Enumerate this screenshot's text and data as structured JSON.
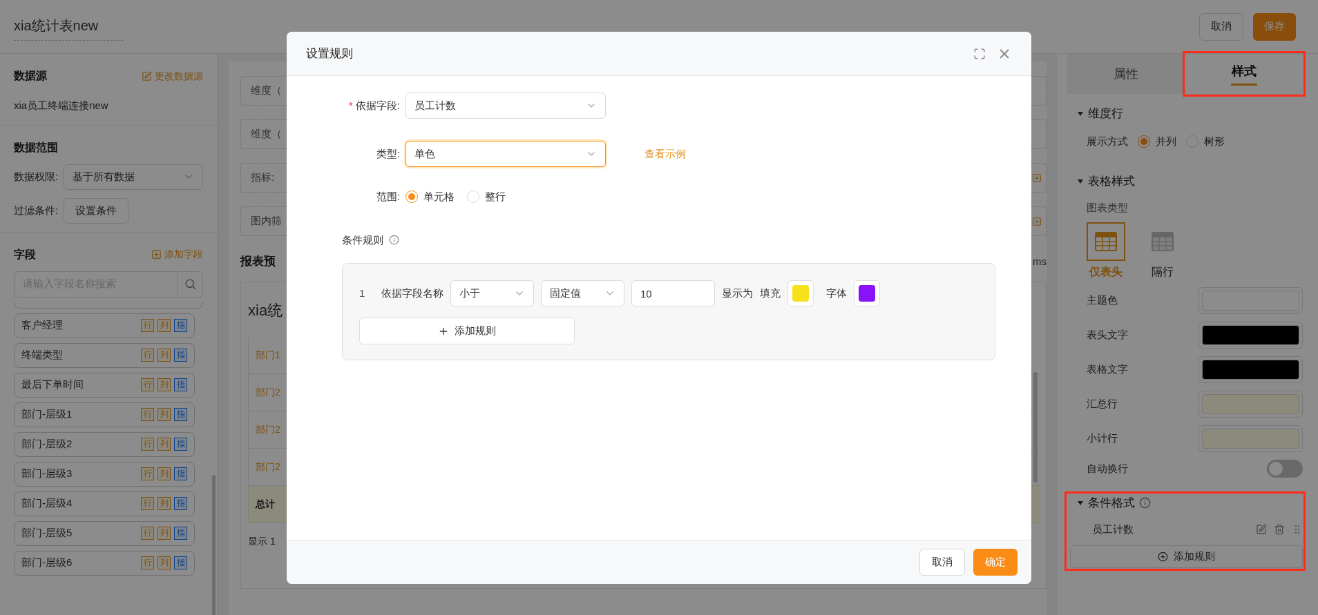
{
  "header": {
    "title": "xia统计表new",
    "buttons": [
      {
        "label": "取消",
        "kind": "secondary"
      },
      {
        "label": "保存",
        "kind": "primary"
      }
    ]
  },
  "sidebar": {
    "data_source": {
      "title": "数据源",
      "action": "更改数据源",
      "value": "xia员工终端连接new"
    },
    "data_range": {
      "title": "数据范围",
      "permission_label": "数据权限:",
      "permission_value": "基于所有数据",
      "filter_label": "过滤条件:",
      "filter_button": "设置条件"
    },
    "fields": {
      "title": "字段",
      "action": "添加字段",
      "search": {
        "placeholder": "请输入字段名称搜索"
      },
      "items": [
        {
          "name": "客户经理",
          "tags": [
            {
              "label": "行",
              "kind": "dimension"
            },
            {
              "label": "列",
              "kind": "dimension"
            },
            {
              "label": "指",
              "kind": "measure"
            }
          ]
        },
        {
          "name": "终端类型",
          "tags": [
            {
              "label": "行",
              "kind": "dimension"
            },
            {
              "label": "列",
              "kind": "dimension"
            },
            {
              "label": "指",
              "kind": "measure"
            }
          ]
        },
        {
          "name": "最后下单时间",
          "tags": [
            {
              "label": "行",
              "kind": "dimension"
            },
            {
              "label": "列",
              "kind": "dimension"
            },
            {
              "label": "指",
              "kind": "measure"
            }
          ]
        },
        {
          "name": "部门-层级1",
          "tags": [
            {
              "label": "行",
              "kind": "dimension"
            },
            {
              "label": "列",
              "kind": "dimension"
            },
            {
              "label": "指",
              "kind": "measure"
            }
          ]
        },
        {
          "name": "部门-层级2",
          "tags": [
            {
              "label": "行",
              "kind": "dimension"
            },
            {
              "label": "列",
              "kind": "dimension"
            },
            {
              "label": "指",
              "kind": "measure"
            }
          ]
        },
        {
          "name": "部门-层级3",
          "tags": [
            {
              "label": "行",
              "kind": "dimension"
            },
            {
              "label": "列",
              "kind": "dimension"
            },
            {
              "label": "指",
              "kind": "measure"
            }
          ]
        },
        {
          "name": "部门-层级4",
          "tags": [
            {
              "label": "行",
              "kind": "dimension"
            },
            {
              "label": "列",
              "kind": "dimension"
            },
            {
              "label": "指",
              "kind": "measure"
            }
          ]
        },
        {
          "name": "部门-层级5",
          "tags": [
            {
              "label": "行",
              "kind": "dimension"
            },
            {
              "label": "列",
              "kind": "dimension"
            },
            {
              "label": "指",
              "kind": "measure"
            }
          ]
        },
        {
          "name": "部门-层级6",
          "tags": [
            {
              "label": "行",
              "kind": "dimension"
            },
            {
              "label": "列",
              "kind": "dimension"
            },
            {
              "label": "指",
              "kind": "measure"
            }
          ]
        }
      ]
    }
  },
  "workspace": {
    "drop_zones": [
      {
        "label": "维度（",
        "has_action": false
      },
      {
        "label": "维度（",
        "has_action": false
      },
      {
        "label": "指标:",
        "has_action": true
      },
      {
        "label": "图内筛",
        "has_action": true
      }
    ],
    "preview_title": "报表预",
    "side_text": "ms",
    "card_title": "xia统",
    "rows": [
      {
        "label": "部门1",
        "kind": "group"
      },
      {
        "label": "部门2",
        "kind": "group"
      },
      {
        "label": "部门2",
        "kind": "group"
      },
      {
        "label": "部门2",
        "kind": "group"
      },
      {
        "label": "总计",
        "kind": "total"
      }
    ],
    "footer": "显示 1"
  },
  "style_panel": {
    "tabs": [
      {
        "label": "属性",
        "selected": false,
        "highlighted": false
      },
      {
        "label": "样式",
        "selected": true,
        "highlighted": true
      }
    ],
    "dimension_row": {
      "title": "维度行",
      "expanded": true,
      "label": "展示方式",
      "options": [
        {
          "label": "并列",
          "selected": true
        },
        {
          "label": "树形",
          "selected": false
        }
      ]
    },
    "table_style": {
      "title": "表格样式",
      "expanded": true,
      "chart_type_label": "图表类型",
      "chart_types": [
        {
          "label": "仅表头",
          "selected": true
        },
        {
          "label": "隔行",
          "selected": false
        }
      ],
      "colors": [
        {
          "label": "主题色",
          "color": "#8c8c8c"
        },
        {
          "label": "表头文字",
          "color": "#000000"
        },
        {
          "label": "表格文字",
          "color": "#000000"
        },
        {
          "label": "汇总行",
          "color": "#8c8a7b"
        },
        {
          "label": "小计行",
          "color": "#8c8a7b"
        }
      ],
      "wrap": {
        "label": "自动换行",
        "on": false
      }
    },
    "conditional_format": {
      "title": "条件格式",
      "expanded": true,
      "highlighted": true,
      "rules": [
        {
          "name": "员工计数"
        }
      ],
      "add_button": "添加规则"
    }
  },
  "modal": {
    "title": "设置规则",
    "basis": {
      "label": "依据字段:",
      "required_mark": "*",
      "value": "员工计数",
      "focused": false
    },
    "type": {
      "label": "类型:",
      "value": "单色",
      "focused": true,
      "link": "查看示例"
    },
    "scope": {
      "label": "范围:",
      "options": [
        {
          "label": "单元格",
          "selected": true
        },
        {
          "label": "整行",
          "selected": false
        }
      ]
    },
    "rules_title": "条件规则",
    "rules": [
      {
        "index": "1",
        "field": "依据字段名称",
        "operator": "小于",
        "value_type": "固定值",
        "value": "10",
        "display_label": "显示为",
        "fill": {
          "label": "填充",
          "color": "#f7e11b"
        },
        "font": {
          "label": "字体",
          "color": "#8a12f7"
        }
      }
    ],
    "add_rule": "添加规则",
    "buttons": [
      {
        "label": "取消",
        "kind": "secondary"
      },
      {
        "label": "确定",
        "kind": "primary"
      }
    ]
  }
}
